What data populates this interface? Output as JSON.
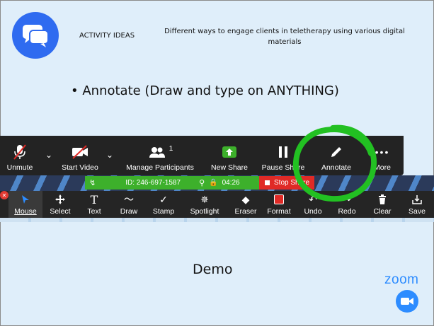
{
  "header": {
    "title": "ACTIVITY IDEAS",
    "subtitle": "Different ways to engage clients in teletherapy using various digital materials"
  },
  "slide": {
    "bullet": "Annotate (Draw and type on ANYTHING)",
    "demo": "Demo"
  },
  "toolbar": {
    "items": [
      {
        "label": "Unmute",
        "icon": "muted-mic-icon"
      },
      {
        "label": "Start Video",
        "icon": "video-off-icon"
      },
      {
        "label": "Manage Participants",
        "icon": "participants-icon",
        "count": "1"
      },
      {
        "label": "New Share",
        "icon": "share-arrow-icon"
      },
      {
        "label": "Pause Share",
        "icon": "pause-icon"
      },
      {
        "label": "Annotate",
        "icon": "pencil-icon"
      },
      {
        "label": "More",
        "icon": "more-dots-icon"
      }
    ]
  },
  "meeting": {
    "id": "ID: 246-697-1587",
    "time": "04:26",
    "stop_share": "Stop Share"
  },
  "annotation_bar": {
    "items": [
      {
        "label": "Mouse",
        "icon": "cursor-icon"
      },
      {
        "label": "Select",
        "icon": "move-icon"
      },
      {
        "label": "Text",
        "icon": "text-icon",
        "glyph": "T"
      },
      {
        "label": "Draw",
        "icon": "draw-icon",
        "glyph": "〜"
      },
      {
        "label": "Stamp",
        "icon": "checkmark-icon",
        "glyph": "✓"
      },
      {
        "label": "Spotlight",
        "icon": "spotlight-icon",
        "glyph": "✵"
      },
      {
        "label": "Eraser",
        "icon": "eraser-icon",
        "glyph": "◆"
      },
      {
        "label": "Format",
        "icon": "format-swatch-icon"
      },
      {
        "label": "Undo",
        "icon": "undo-icon",
        "glyph": "↶"
      },
      {
        "label": "Redo",
        "icon": "redo-icon",
        "glyph": "↷"
      },
      {
        "label": "Clear",
        "icon": "trash-icon",
        "glyph": "🗑"
      },
      {
        "label": "Save",
        "icon": "save-icon",
        "glyph": "⤓"
      }
    ]
  },
  "branding": {
    "zoom_word": "zoom"
  },
  "colors": {
    "background": "#dfeefa",
    "toolbar": "#232323",
    "meeting_green": "#3db02b",
    "stop_red": "#e02a26",
    "zoom_blue": "#2d8cff",
    "highlight_circle": "#22c022"
  }
}
